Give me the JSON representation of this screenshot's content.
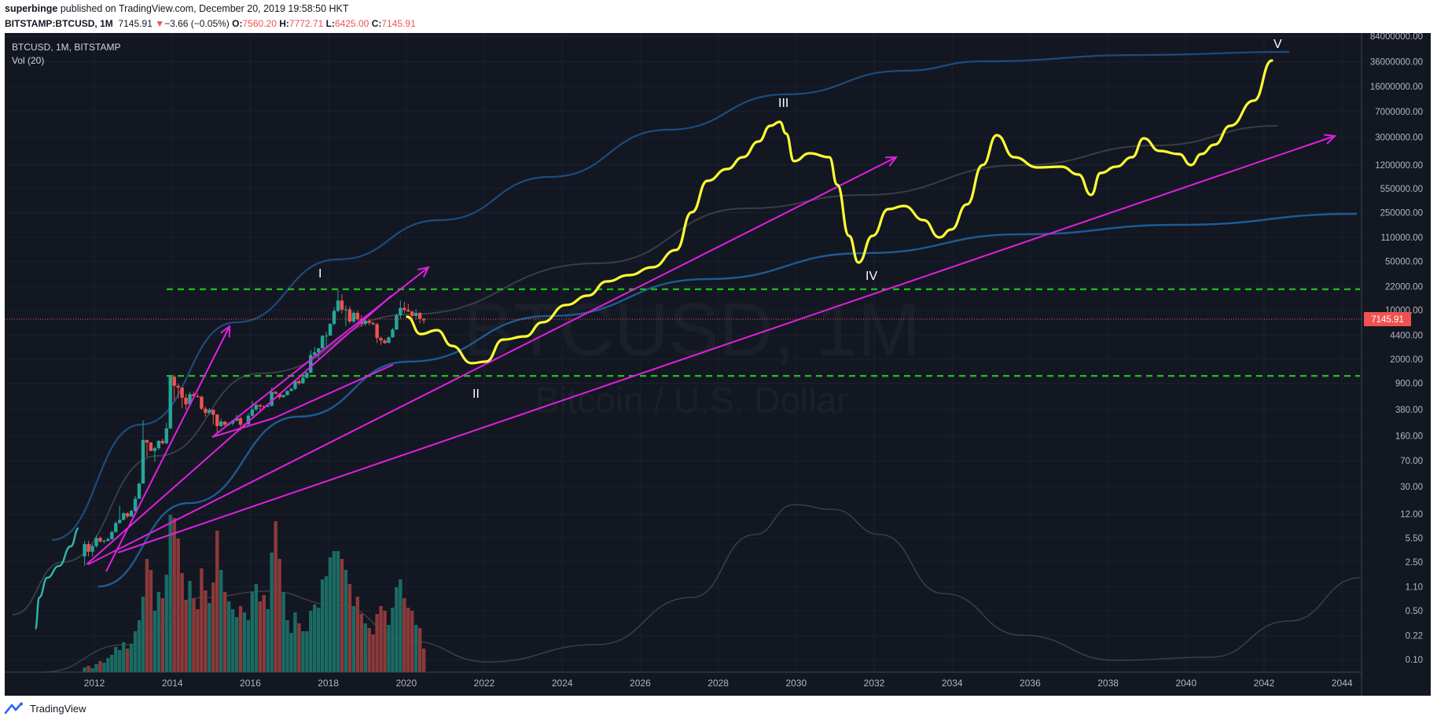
{
  "publish": {
    "author": "superbinge",
    "rest": " published on TradingView.com, December 20, 2019 19:58:50 HKT"
  },
  "symbol_line": {
    "symbol": "BITSTAMP:BTCUSD, 1M",
    "price": "7145.91",
    "change_arrow": "▼",
    "change": "−3.66 (−0.05%)",
    "o_label": "O:",
    "o_val": "7560.20",
    "h_label": "H:",
    "h_val": "7772.71",
    "l_label": "L:",
    "l_val": "6425.00",
    "c_label": "C:",
    "c_val": "7145.91"
  },
  "legend": {
    "main": "BTCUSD, 1M, BITSTAMP",
    "vol": "Vol (20)"
  },
  "watermark": {
    "symbol": "BTCUSD, 1M",
    "name": "Bitcoin / U.S. Dollar"
  },
  "footer": {
    "brand": "TradingView",
    "logo_icon": "tradingview-logo-icon"
  },
  "colors": {
    "background": "#131722",
    "up": "#26a69a",
    "down": "#ef5350",
    "projection": "#ffff33",
    "trendline": "#e020e0",
    "support": "#1fba1f",
    "band": "#1c4c7c",
    "ma": "#4a4a4a",
    "current_price": "#ef5350"
  },
  "chart_data": {
    "type": "line",
    "scale": "log",
    "x_ticks": [
      "2012",
      "2014",
      "2016",
      "2018",
      "2020",
      "2022",
      "2024",
      "2026",
      "2028",
      "2030",
      "2032",
      "2034",
      "2036",
      "2038",
      "2040",
      "2042",
      "2044"
    ],
    "y_ticks": [
      "84000000.00",
      "36000000.00",
      "16000000.00",
      "7000000.00",
      "3000000.00",
      "1200000.00",
      "550000.00",
      "250000.00",
      "110000.00",
      "50000.00",
      "22000.00",
      "10000.00",
      "4400.00",
      "2000.00",
      "900.00",
      "380.00",
      "160.00",
      "70.00",
      "30.00",
      "12.00",
      "5.50",
      "2.50",
      "1.10",
      "0.50",
      "0.22",
      "0.10"
    ],
    "current_price": 7145.91,
    "current_price_label": "7145.91",
    "wave_labels": [
      "I",
      "II",
      "III",
      "IV",
      "V"
    ],
    "candles": [
      [
        2011.75,
        3,
        5,
        2.2,
        4.5
      ],
      [
        2011.85,
        4.5,
        5,
        3,
        3.5
      ],
      [
        2011.95,
        3.5,
        4.5,
        3,
        4.2
      ],
      [
        2012.05,
        4.2,
        6,
        4,
        5.5
      ],
      [
        2012.15,
        5.5,
        5.8,
        4.7,
        4.9
      ],
      [
        2012.25,
        4.9,
        5.2,
        4.6,
        5.0
      ],
      [
        2012.35,
        5.0,
        5.6,
        4.9,
        5.3
      ],
      [
        2012.45,
        5.3,
        7,
        5.2,
        6.7
      ],
      [
        2012.55,
        6.7,
        9.5,
        6.5,
        9.0
      ],
      [
        2012.65,
        9.0,
        16,
        8.8,
        10
      ],
      [
        2012.75,
        10,
        13,
        9.8,
        12.4
      ],
      [
        2012.85,
        12.4,
        12.9,
        10.5,
        11.2
      ],
      [
        2012.95,
        11.2,
        14,
        11,
        13.4
      ],
      [
        2013.05,
        13.4,
        22,
        13,
        20
      ],
      [
        2013.15,
        20,
        34,
        20,
        33
      ],
      [
        2013.25,
        33,
        266,
        50,
        139
      ],
      [
        2013.35,
        139,
        140,
        80,
        128
      ],
      [
        2013.45,
        128,
        130,
        96,
        97
      ],
      [
        2013.55,
        97,
        112,
        68,
        106
      ],
      [
        2013.65,
        106,
        139,
        100,
        135
      ],
      [
        2013.75,
        135,
        145,
        120,
        125
      ],
      [
        2013.85,
        125,
        245,
        120,
        204
      ],
      [
        2013.95,
        204,
        1160,
        200,
        1120
      ],
      [
        2014.05,
        1120,
        1200,
        500,
        830
      ],
      [
        2014.15,
        830,
        900,
        540,
        780
      ],
      [
        2014.25,
        780,
        790,
        400,
        560
      ],
      [
        2014.35,
        560,
        640,
        380,
        450
      ],
      [
        2014.45,
        450,
        680,
        420,
        630
      ],
      [
        2014.55,
        630,
        680,
        550,
        590
      ],
      [
        2014.65,
        590,
        640,
        560,
        580
      ],
      [
        2014.75,
        580,
        600,
        370,
        390
      ],
      [
        2014.85,
        390,
        420,
        300,
        340
      ],
      [
        2014.95,
        340,
        400,
        320,
        375
      ],
      [
        2015.05,
        375,
        380,
        230,
        320
      ],
      [
        2015.15,
        320,
        330,
        160,
        220
      ],
      [
        2015.25,
        220,
        280,
        210,
        255
      ],
      [
        2015.35,
        255,
        260,
        220,
        230
      ],
      [
        2015.45,
        230,
        250,
        220,
        240
      ],
      [
        2015.55,
        240,
        270,
        225,
        263
      ],
      [
        2015.65,
        263,
        320,
        255,
        285
      ],
      [
        2015.75,
        285,
        300,
        190,
        230
      ],
      [
        2015.85,
        230,
        240,
        225,
        232
      ],
      [
        2015.95,
        232,
        340,
        230,
        310
      ],
      [
        2016.05,
        310,
        500,
        300,
        380
      ],
      [
        2016.15,
        380,
        470,
        360,
        440
      ],
      [
        2016.25,
        440,
        450,
        360,
        420
      ],
      [
        2016.35,
        420,
        440,
        400,
        415
      ],
      [
        2016.45,
        415,
        450,
        410,
        430
      ],
      [
        2016.55,
        430,
        780,
        420,
        680
      ],
      [
        2016.65,
        680,
        700,
        620,
        640
      ],
      [
        2016.75,
        640,
        650,
        530,
        570
      ],
      [
        2016.85,
        570,
        620,
        560,
        610
      ],
      [
        2016.95,
        610,
        710,
        600,
        700
      ],
      [
        2017.05,
        700,
        780,
        690,
        750
      ],
      [
        2017.15,
        750,
        1000,
        720,
        970
      ],
      [
        2017.25,
        970,
        1050,
        850,
        900
      ],
      [
        2017.35,
        900,
        1200,
        880,
        1080
      ],
      [
        2017.45,
        1080,
        1300,
        1050,
        1280
      ],
      [
        2017.55,
        1280,
        2700,
        1250,
        2300
      ],
      [
        2017.65,
        2300,
        3000,
        2200,
        2500
      ],
      [
        2017.75,
        2500,
        2900,
        1900,
        2850
      ],
      [
        2017.85,
        2850,
        4400,
        2800,
        4300
      ],
      [
        2017.95,
        4300,
        4900,
        3000,
        4350
      ],
      [
        2018.05,
        4350,
        6500,
        4300,
        6400
      ],
      [
        2018.15,
        6400,
        11000,
        6000,
        9800
      ],
      [
        2018.25,
        9800,
        19800,
        9400,
        13800
      ],
      [
        2018.35,
        13800,
        17000,
        9000,
        10200
      ],
      [
        2018.45,
        10200,
        11800,
        5900,
        10300
      ],
      [
        2018.55,
        10300,
        11400,
        6500,
        6900
      ],
      [
        2018.65,
        6900,
        9800,
        6500,
        9200
      ],
      [
        2018.75,
        9200,
        9900,
        7100,
        7500
      ],
      [
        2018.85,
        7500,
        8500,
        5800,
        6400
      ],
      [
        2018.95,
        6400,
        7500,
        5900,
        7100
      ],
      [
        2019.05,
        7100,
        7400,
        6100,
        6600
      ],
      [
        2019.15,
        6600,
        6800,
        6100,
        6300
      ],
      [
        2019.25,
        6300,
        6600,
        3400,
        4000
      ],
      [
        2019.35,
        4000,
        4200,
        3200,
        3700
      ],
      [
        2019.45,
        3700,
        3900,
        3300,
        3400
      ],
      [
        2019.55,
        3400,
        4200,
        3400,
        4100
      ],
      [
        2019.65,
        4100,
        5600,
        4050,
        5300
      ],
      [
        2019.75,
        5300,
        9000,
        5250,
        8500
      ],
      [
        2019.85,
        8500,
        13800,
        7500,
        10800
      ],
      [
        2019.95,
        10800,
        13200,
        9100,
        10100
      ],
      [
        2020.05,
        10100,
        12400,
        9400,
        9600
      ],
      [
        2020.15,
        9600,
        9800,
        7700,
        8300
      ],
      [
        2020.25,
        8300,
        10400,
        7400,
        9150
      ],
      [
        2020.35,
        9150,
        9500,
        6500,
        7560
      ],
      [
        2020.45,
        7560,
        7772,
        6425,
        7146
      ]
    ],
    "volume": [
      [
        2011.75,
        30
      ],
      [
        2011.85,
        40
      ],
      [
        2011.95,
        25
      ],
      [
        2012.05,
        50
      ],
      [
        2012.15,
        70
      ],
      [
        2012.25,
        60
      ],
      [
        2012.35,
        90
      ],
      [
        2012.45,
        110
      ],
      [
        2012.55,
        160
      ],
      [
        2012.65,
        140
      ],
      [
        2012.75,
        190
      ],
      [
        2012.85,
        150
      ],
      [
        2012.95,
        180
      ],
      [
        2013.05,
        260
      ],
      [
        2013.15,
        330
      ],
      [
        2013.25,
        480
      ],
      [
        2013.35,
        720
      ],
      [
        2013.45,
        650
      ],
      [
        2013.55,
        390
      ],
      [
        2013.65,
        510
      ],
      [
        2013.75,
        470
      ],
      [
        2013.85,
        620
      ],
      [
        2013.95,
        1000
      ],
      [
        2014.05,
        980
      ],
      [
        2014.15,
        850
      ],
      [
        2014.25,
        630
      ],
      [
        2014.35,
        460
      ],
      [
        2014.45,
        580
      ],
      [
        2014.55,
        470
      ],
      [
        2014.65,
        400
      ],
      [
        2014.75,
        660
      ],
      [
        2014.85,
        520
      ],
      [
        2014.95,
        440
      ],
      [
        2015.05,
        570
      ],
      [
        2015.15,
        900
      ],
      [
        2015.25,
        650
      ],
      [
        2015.35,
        510
      ],
      [
        2015.45,
        450
      ],
      [
        2015.55,
        400
      ],
      [
        2015.65,
        350
      ],
      [
        2015.75,
        420
      ],
      [
        2015.85,
        380
      ],
      [
        2015.95,
        330
      ],
      [
        2016.05,
        510
      ],
      [
        2016.15,
        560
      ],
      [
        2016.25,
        450
      ],
      [
        2016.35,
        490
      ],
      [
        2016.45,
        400
      ],
      [
        2016.55,
        760
      ],
      [
        2016.65,
        960
      ],
      [
        2016.75,
        720
      ],
      [
        2016.85,
        510
      ],
      [
        2016.95,
        330
      ],
      [
        2017.05,
        250
      ],
      [
        2017.15,
        380
      ],
      [
        2017.25,
        310
      ],
      [
        2017.35,
        260
      ],
      [
        2017.45,
        260
      ],
      [
        2017.55,
        390
      ],
      [
        2017.65,
        430
      ],
      [
        2017.75,
        410
      ],
      [
        2017.85,
        590
      ],
      [
        2017.95,
        610
      ],
      [
        2018.05,
        730
      ],
      [
        2018.15,
        770
      ],
      [
        2018.25,
        770
      ],
      [
        2018.35,
        720
      ],
      [
        2018.45,
        650
      ],
      [
        2018.55,
        560
      ],
      [
        2018.65,
        420
      ],
      [
        2018.75,
        480
      ],
      [
        2018.85,
        370
      ],
      [
        2018.95,
        310
      ],
      [
        2019.05,
        280
      ],
      [
        2019.15,
        240
      ],
      [
        2019.25,
        370
      ],
      [
        2019.35,
        420
      ],
      [
        2019.45,
        390
      ],
      [
        2019.55,
        300
      ],
      [
        2019.65,
        410
      ],
      [
        2019.75,
        540
      ],
      [
        2019.85,
        590
      ],
      [
        2019.95,
        470
      ],
      [
        2020.05,
        410
      ],
      [
        2020.15,
        390
      ],
      [
        2020.25,
        300
      ],
      [
        2020.35,
        280
      ],
      [
        2020.45,
        150
      ]
    ]
  }
}
